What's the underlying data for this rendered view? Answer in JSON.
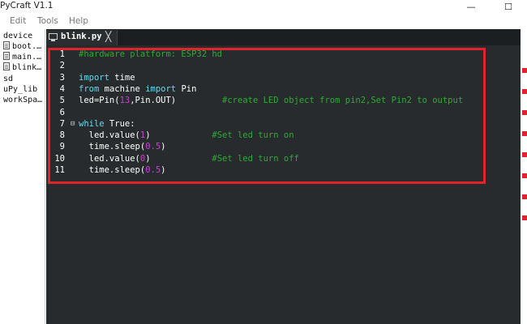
{
  "window": {
    "title": "PyCraft V1.1",
    "minimize_glyph": "—",
    "maximize_glyph": "☐"
  },
  "menu": [
    "Edit",
    "Tools",
    "Help"
  ],
  "sidebar": {
    "items": [
      {
        "label": "device",
        "type": "folder"
      },
      {
        "label": "boot.…",
        "type": "file"
      },
      {
        "label": "main.…",
        "type": "file"
      },
      {
        "label": "blink…",
        "type": "file"
      },
      {
        "label": "sd",
        "type": "folder"
      },
      {
        "label": "uPy_lib",
        "type": "folder"
      },
      {
        "label": "workSpa…",
        "type": "folder"
      }
    ]
  },
  "editor": {
    "tab": {
      "label": "blink.py",
      "close_glyph": "╳"
    },
    "lines": [
      {
        "n": "1",
        "parts": [
          {
            "t": "#hardware platform: ESP32 hd",
            "c": "cm"
          }
        ]
      },
      {
        "n": "2",
        "parts": []
      },
      {
        "n": "3",
        "parts": [
          {
            "t": "import",
            "c": "kw"
          },
          {
            "t": " time",
            "c": "plain"
          }
        ]
      },
      {
        "n": "4",
        "parts": [
          {
            "t": "from",
            "c": "kw"
          },
          {
            "t": " machine ",
            "c": "plain"
          },
          {
            "t": "import",
            "c": "kw"
          },
          {
            "t": " Pin",
            "c": "plain"
          }
        ]
      },
      {
        "n": "5",
        "parts": [
          {
            "t": "led=Pin(",
            "c": "plain"
          },
          {
            "t": "13",
            "c": "num"
          },
          {
            "t": ",Pin.OUT)         ",
            "c": "plain"
          },
          {
            "t": "#create LED object from pin2,Set Pin2 to output",
            "c": "cm"
          }
        ]
      },
      {
        "n": "6",
        "parts": []
      },
      {
        "n": "7",
        "fold": "⊟",
        "parts": [
          {
            "t": "while",
            "c": "kw"
          },
          {
            "t": " True:",
            "c": "plain"
          }
        ]
      },
      {
        "n": "8",
        "parts": [
          {
            "t": "  led.value(",
            "c": "plain"
          },
          {
            "t": "1",
            "c": "num"
          },
          {
            "t": ")            ",
            "c": "plain"
          },
          {
            "t": "#Set led turn on",
            "c": "cm"
          }
        ]
      },
      {
        "n": "9",
        "parts": [
          {
            "t": "  time.sleep(",
            "c": "plain"
          },
          {
            "t": "0.5",
            "c": "num"
          },
          {
            "t": ")",
            "c": "plain"
          }
        ]
      },
      {
        "n": "10",
        "parts": [
          {
            "t": "  led.value(",
            "c": "plain"
          },
          {
            "t": "0",
            "c": "num"
          },
          {
            "t": ")            ",
            "c": "plain"
          },
          {
            "t": "#Set led turn off",
            "c": "cm"
          }
        ]
      },
      {
        "n": "11",
        "parts": [
          {
            "t": "  time.sleep(",
            "c": "plain"
          },
          {
            "t": "0.5",
            "c": "num"
          },
          {
            "t": ")",
            "c": "plain"
          }
        ]
      }
    ]
  },
  "colors": {
    "editor_bg": "#272b2d",
    "keyword": "#66d9ef",
    "number": "#cc3fd6",
    "comment": "#31a836",
    "highlight_frame": "#e0242c"
  }
}
